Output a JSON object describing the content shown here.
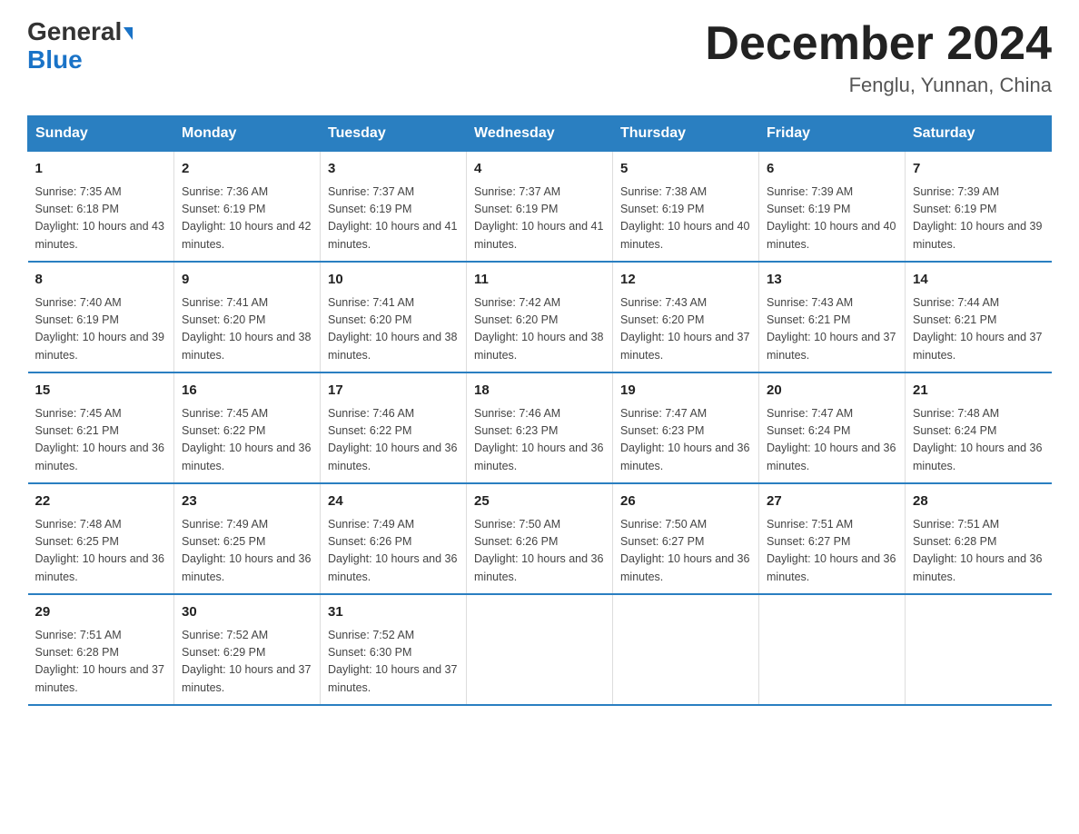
{
  "header": {
    "logo_general": "General",
    "logo_blue": "Blue",
    "main_title": "December 2024",
    "subtitle": "Fenglu, Yunnan, China"
  },
  "days_of_week": [
    "Sunday",
    "Monday",
    "Tuesday",
    "Wednesday",
    "Thursday",
    "Friday",
    "Saturday"
  ],
  "weeks": [
    [
      {
        "num": "1",
        "sunrise": "7:35 AM",
        "sunset": "6:18 PM",
        "daylight": "10 hours and 43 minutes."
      },
      {
        "num": "2",
        "sunrise": "7:36 AM",
        "sunset": "6:19 PM",
        "daylight": "10 hours and 42 minutes."
      },
      {
        "num": "3",
        "sunrise": "7:37 AM",
        "sunset": "6:19 PM",
        "daylight": "10 hours and 41 minutes."
      },
      {
        "num": "4",
        "sunrise": "7:37 AM",
        "sunset": "6:19 PM",
        "daylight": "10 hours and 41 minutes."
      },
      {
        "num": "5",
        "sunrise": "7:38 AM",
        "sunset": "6:19 PM",
        "daylight": "10 hours and 40 minutes."
      },
      {
        "num": "6",
        "sunrise": "7:39 AM",
        "sunset": "6:19 PM",
        "daylight": "10 hours and 40 minutes."
      },
      {
        "num": "7",
        "sunrise": "7:39 AM",
        "sunset": "6:19 PM",
        "daylight": "10 hours and 39 minutes."
      }
    ],
    [
      {
        "num": "8",
        "sunrise": "7:40 AM",
        "sunset": "6:19 PM",
        "daylight": "10 hours and 39 minutes."
      },
      {
        "num": "9",
        "sunrise": "7:41 AM",
        "sunset": "6:20 PM",
        "daylight": "10 hours and 38 minutes."
      },
      {
        "num": "10",
        "sunrise": "7:41 AM",
        "sunset": "6:20 PM",
        "daylight": "10 hours and 38 minutes."
      },
      {
        "num": "11",
        "sunrise": "7:42 AM",
        "sunset": "6:20 PM",
        "daylight": "10 hours and 38 minutes."
      },
      {
        "num": "12",
        "sunrise": "7:43 AM",
        "sunset": "6:20 PM",
        "daylight": "10 hours and 37 minutes."
      },
      {
        "num": "13",
        "sunrise": "7:43 AM",
        "sunset": "6:21 PM",
        "daylight": "10 hours and 37 minutes."
      },
      {
        "num": "14",
        "sunrise": "7:44 AM",
        "sunset": "6:21 PM",
        "daylight": "10 hours and 37 minutes."
      }
    ],
    [
      {
        "num": "15",
        "sunrise": "7:45 AM",
        "sunset": "6:21 PM",
        "daylight": "10 hours and 36 minutes."
      },
      {
        "num": "16",
        "sunrise": "7:45 AM",
        "sunset": "6:22 PM",
        "daylight": "10 hours and 36 minutes."
      },
      {
        "num": "17",
        "sunrise": "7:46 AM",
        "sunset": "6:22 PM",
        "daylight": "10 hours and 36 minutes."
      },
      {
        "num": "18",
        "sunrise": "7:46 AM",
        "sunset": "6:23 PM",
        "daylight": "10 hours and 36 minutes."
      },
      {
        "num": "19",
        "sunrise": "7:47 AM",
        "sunset": "6:23 PM",
        "daylight": "10 hours and 36 minutes."
      },
      {
        "num": "20",
        "sunrise": "7:47 AM",
        "sunset": "6:24 PM",
        "daylight": "10 hours and 36 minutes."
      },
      {
        "num": "21",
        "sunrise": "7:48 AM",
        "sunset": "6:24 PM",
        "daylight": "10 hours and 36 minutes."
      }
    ],
    [
      {
        "num": "22",
        "sunrise": "7:48 AM",
        "sunset": "6:25 PM",
        "daylight": "10 hours and 36 minutes."
      },
      {
        "num": "23",
        "sunrise": "7:49 AM",
        "sunset": "6:25 PM",
        "daylight": "10 hours and 36 minutes."
      },
      {
        "num": "24",
        "sunrise": "7:49 AM",
        "sunset": "6:26 PM",
        "daylight": "10 hours and 36 minutes."
      },
      {
        "num": "25",
        "sunrise": "7:50 AM",
        "sunset": "6:26 PM",
        "daylight": "10 hours and 36 minutes."
      },
      {
        "num": "26",
        "sunrise": "7:50 AM",
        "sunset": "6:27 PM",
        "daylight": "10 hours and 36 minutes."
      },
      {
        "num": "27",
        "sunrise": "7:51 AM",
        "sunset": "6:27 PM",
        "daylight": "10 hours and 36 minutes."
      },
      {
        "num": "28",
        "sunrise": "7:51 AM",
        "sunset": "6:28 PM",
        "daylight": "10 hours and 36 minutes."
      }
    ],
    [
      {
        "num": "29",
        "sunrise": "7:51 AM",
        "sunset": "6:28 PM",
        "daylight": "10 hours and 37 minutes."
      },
      {
        "num": "30",
        "sunrise": "7:52 AM",
        "sunset": "6:29 PM",
        "daylight": "10 hours and 37 minutes."
      },
      {
        "num": "31",
        "sunrise": "7:52 AM",
        "sunset": "6:30 PM",
        "daylight": "10 hours and 37 minutes."
      },
      null,
      null,
      null,
      null
    ]
  ]
}
